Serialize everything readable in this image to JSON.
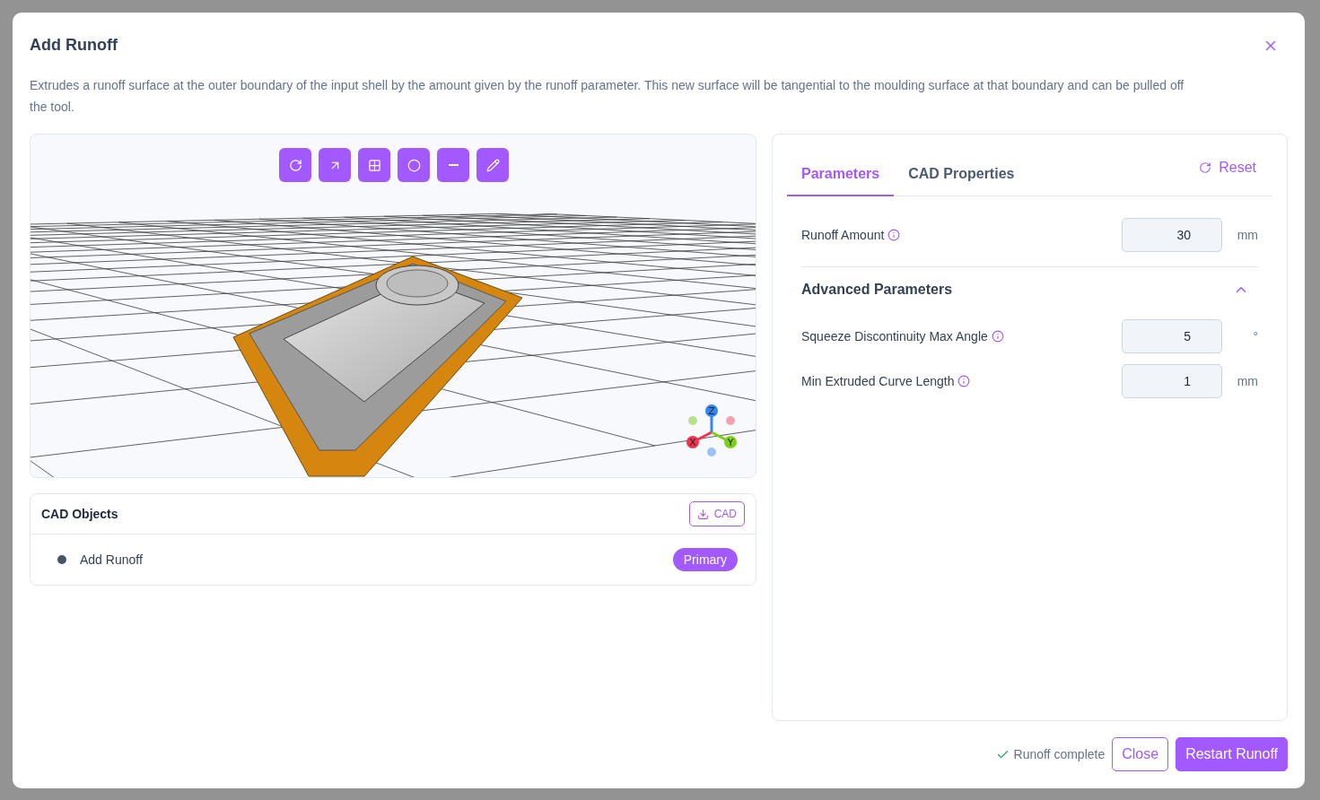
{
  "dialog": {
    "title": "Add Runoff",
    "description": "Extrudes a runoff surface at the outer boundary of the input shell by the amount given by the runoff parameter. This new surface will be tangential to the moulding surface at that boundary and can be pulled off the tool."
  },
  "viewport": {
    "axes": [
      {
        "label": "Z",
        "color": "#2f86f6"
      },
      {
        "label": "X",
        "color": "#f0344f"
      },
      {
        "label": "Y",
        "color": "#7ccf14"
      }
    ]
  },
  "cad_objects": {
    "title": "CAD Objects",
    "download_button": "CAD",
    "items": [
      {
        "name": "Add Runoff",
        "badge": "Primary"
      }
    ]
  },
  "tabs": [
    {
      "label": "Parameters",
      "selected": true
    },
    {
      "label": "CAD Properties",
      "selected": false
    }
  ],
  "reset_button": "Reset",
  "parameters": [
    {
      "label": "Runoff Amount",
      "value": "30",
      "unit": "mm"
    }
  ],
  "advanced": {
    "title": "Advanced Parameters",
    "expanded": true,
    "parameters": [
      {
        "label": "Squeeze Discontinuity Max Angle",
        "value": "5",
        "unit": "°"
      },
      {
        "label": "Min Extruded Curve Length",
        "value": "1",
        "unit": "mm"
      }
    ]
  },
  "footer": {
    "status": "Runoff complete",
    "buttons": [
      {
        "label": "Close",
        "kind": "outline"
      },
      {
        "label": "Restart Runoff",
        "kind": "primary"
      }
    ]
  }
}
